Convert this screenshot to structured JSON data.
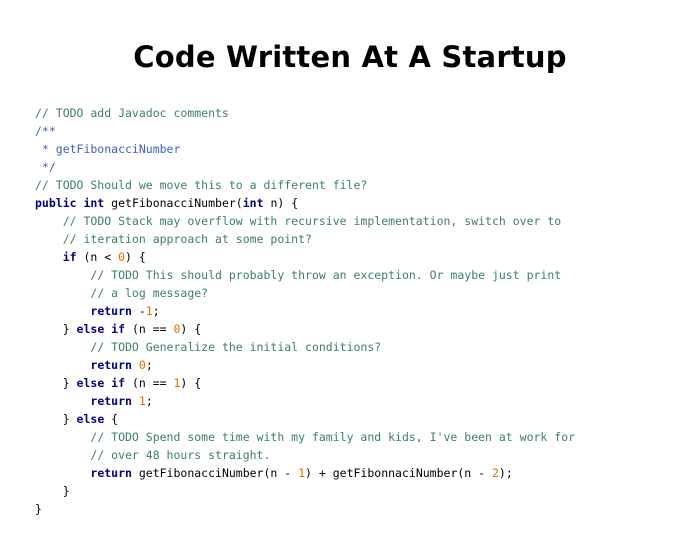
{
  "title": "Code Written At A Startup",
  "colors": {
    "comment": "#3f7f5f",
    "javadoc": "#3f5fbf",
    "keyword": "#00007f",
    "number": "#e07000",
    "text": "#000000"
  },
  "code_lines": [
    [
      {
        "t": "cm",
        "v": "// TODO add Javadoc comments"
      }
    ],
    [
      {
        "t": "jd",
        "v": "/**"
      }
    ],
    [
      {
        "t": "jd",
        "v": " * getFibonacciNumber"
      }
    ],
    [
      {
        "t": "jd",
        "v": " */"
      }
    ],
    [
      {
        "t": "cm",
        "v": "// TODO Should we move this to a different file?"
      }
    ],
    [
      {
        "t": "kw",
        "v": "public int"
      },
      {
        "t": "tx",
        "v": " getFibonacciNumber("
      },
      {
        "t": "kw",
        "v": "int"
      },
      {
        "t": "tx",
        "v": " n) {"
      }
    ],
    [
      {
        "t": "tx",
        "v": "    "
      },
      {
        "t": "cm",
        "v": "// TODO Stack may overflow with recursive implementation, switch over to"
      }
    ],
    [
      {
        "t": "tx",
        "v": "    "
      },
      {
        "t": "cm",
        "v": "// iteration approach at some point?"
      }
    ],
    [
      {
        "t": "tx",
        "v": "    "
      },
      {
        "t": "kw",
        "v": "if"
      },
      {
        "t": "tx",
        "v": " (n < "
      },
      {
        "t": "nm",
        "v": "0"
      },
      {
        "t": "tx",
        "v": ") {"
      }
    ],
    [
      {
        "t": "tx",
        "v": "        "
      },
      {
        "t": "cm",
        "v": "// TODO This should probably throw an exception. Or maybe just print"
      }
    ],
    [
      {
        "t": "tx",
        "v": "        "
      },
      {
        "t": "cm",
        "v": "// a log message?"
      }
    ],
    [
      {
        "t": "tx",
        "v": "        "
      },
      {
        "t": "kw",
        "v": "return"
      },
      {
        "t": "tx",
        "v": " -"
      },
      {
        "t": "nm",
        "v": "1"
      },
      {
        "t": "tx",
        "v": ";"
      }
    ],
    [
      {
        "t": "tx",
        "v": "    } "
      },
      {
        "t": "kw",
        "v": "else if"
      },
      {
        "t": "tx",
        "v": " (n == "
      },
      {
        "t": "nm",
        "v": "0"
      },
      {
        "t": "tx",
        "v": ") {"
      }
    ],
    [
      {
        "t": "tx",
        "v": "        "
      },
      {
        "t": "cm",
        "v": "// TODO Generalize the initial conditions?"
      }
    ],
    [
      {
        "t": "tx",
        "v": "        "
      },
      {
        "t": "kw",
        "v": "return"
      },
      {
        "t": "tx",
        "v": " "
      },
      {
        "t": "nm",
        "v": "0"
      },
      {
        "t": "tx",
        "v": ";"
      }
    ],
    [
      {
        "t": "tx",
        "v": "    } "
      },
      {
        "t": "kw",
        "v": "else if"
      },
      {
        "t": "tx",
        "v": " (n == "
      },
      {
        "t": "nm",
        "v": "1"
      },
      {
        "t": "tx",
        "v": ") {"
      }
    ],
    [
      {
        "t": "tx",
        "v": "        "
      },
      {
        "t": "kw",
        "v": "return"
      },
      {
        "t": "tx",
        "v": " "
      },
      {
        "t": "nm",
        "v": "1"
      },
      {
        "t": "tx",
        "v": ";"
      }
    ],
    [
      {
        "t": "tx",
        "v": "    } "
      },
      {
        "t": "kw",
        "v": "else"
      },
      {
        "t": "tx",
        "v": " {"
      }
    ],
    [
      {
        "t": "tx",
        "v": "        "
      },
      {
        "t": "cm",
        "v": "// TODO Spend some time with my family and kids, I've been at work for"
      }
    ],
    [
      {
        "t": "tx",
        "v": "        "
      },
      {
        "t": "cm",
        "v": "// over 48 hours straight."
      }
    ],
    [
      {
        "t": "tx",
        "v": "        "
      },
      {
        "t": "kw",
        "v": "return"
      },
      {
        "t": "tx",
        "v": " getFibonacciNumber(n - "
      },
      {
        "t": "nm",
        "v": "1"
      },
      {
        "t": "tx",
        "v": ") + getFibonnaciNumber(n - "
      },
      {
        "t": "nm",
        "v": "2"
      },
      {
        "t": "tx",
        "v": ");"
      }
    ],
    [
      {
        "t": "tx",
        "v": "    }"
      }
    ],
    [
      {
        "t": "tx",
        "v": "}"
      }
    ]
  ]
}
